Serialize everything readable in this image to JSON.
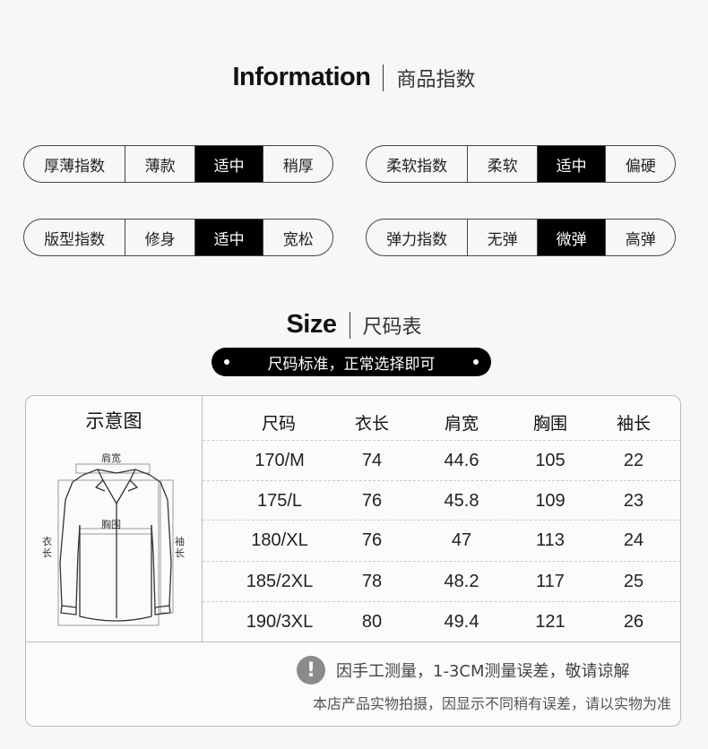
{
  "information": {
    "title_en": "Information",
    "title_cn": "商品指数"
  },
  "indices": [
    {
      "label": "厚薄指数",
      "options": [
        "薄款",
        "适中",
        "稍厚"
      ],
      "selected": 1
    },
    {
      "label": "柔软指数",
      "options": [
        "柔软",
        "适中",
        "偏硬"
      ],
      "selected": 1
    },
    {
      "label": "版型指数",
      "options": [
        "修身",
        "适中",
        "宽松"
      ],
      "selected": 1
    },
    {
      "label": "弹力指数",
      "options": [
        "无弹",
        "微弹",
        "高弹"
      ],
      "selected": 1
    }
  ],
  "size": {
    "title_en": "Size",
    "title_cn": "尺码表",
    "banner": "尺码标准，正常选择即可",
    "diagram_title": "示意图",
    "diagram_labels": {
      "shoulder": "肩宽",
      "chest": "胸围",
      "length": "衣长",
      "sleeve": "袖长"
    },
    "headers": [
      "尺码",
      "衣长",
      "肩宽",
      "胸围",
      "袖长"
    ],
    "rows": [
      [
        "170/M",
        "74",
        "44.6",
        "105",
        "22"
      ],
      [
        "175/L",
        "76",
        "45.8",
        "109",
        "23"
      ],
      [
        "180/XL",
        "76",
        "47",
        "113",
        "24"
      ],
      [
        "185/2XL",
        "78",
        "48.2",
        "117",
        "25"
      ],
      [
        "190/3XL",
        "80",
        "49.4",
        "121",
        "26"
      ]
    ],
    "note_icon": "exclamation-icon",
    "note_measure": "因手工测量，1-3CM测量误差，敬请谅解",
    "note_photo": "本店产品实物拍摄，因显示不同稍有误差，请以实物为准"
  }
}
